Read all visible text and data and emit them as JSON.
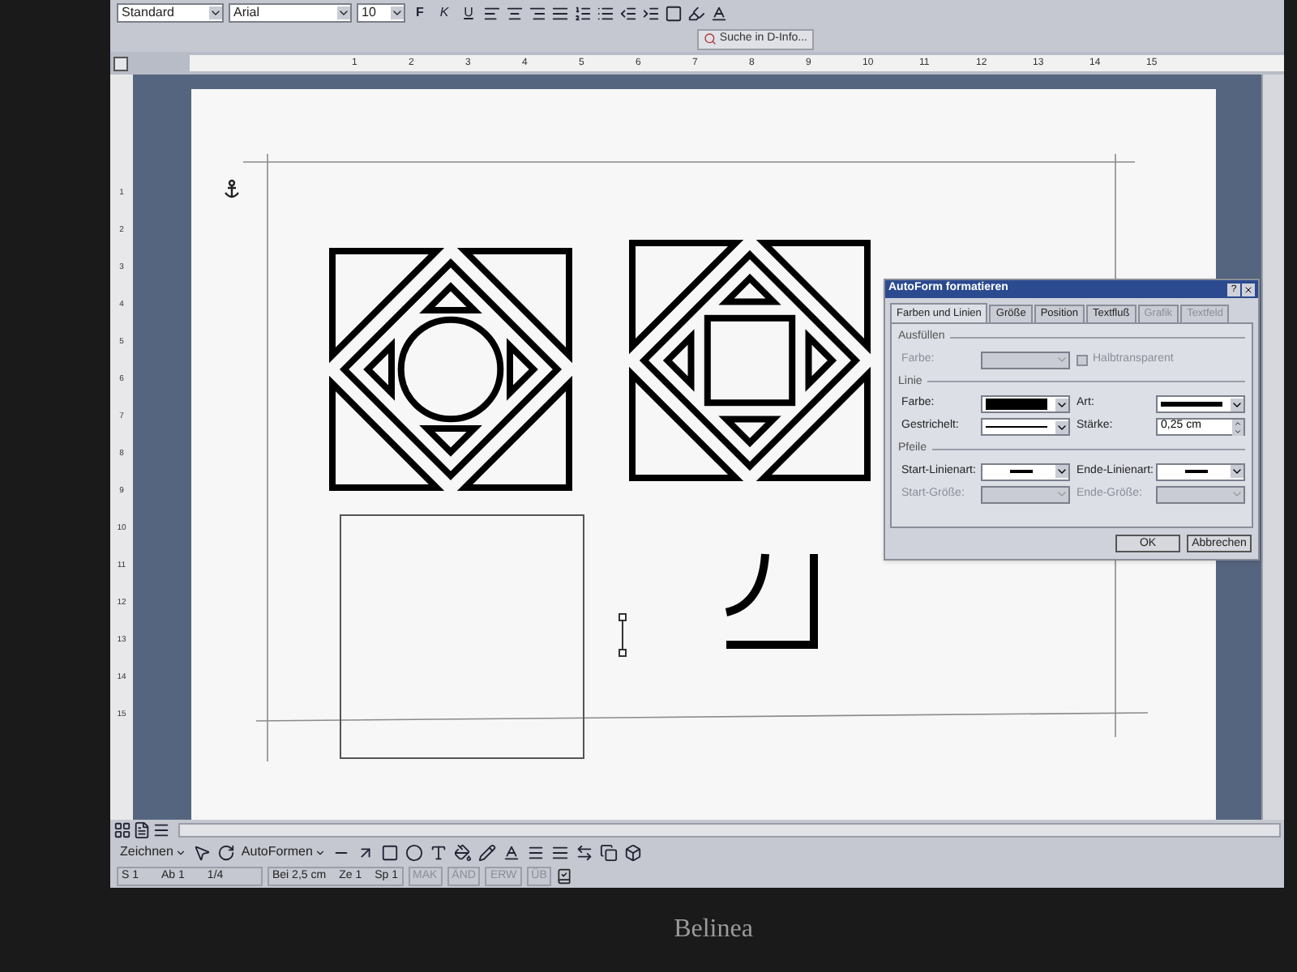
{
  "format_toolbar": {
    "style": "Standard",
    "font": "Arial",
    "size": "10",
    "buttons": [
      {
        "label": "F",
        "kind": "bold"
      },
      {
        "label": "K",
        "kind": "italic"
      },
      {
        "label": "U",
        "kind": "underline"
      }
    ]
  },
  "task_pane_search": {
    "label": "Suche in D-Info..."
  },
  "ruler": {
    "marks": [
      "1",
      "2",
      "3",
      "4",
      "5",
      "6",
      "7",
      "8",
      "9",
      "10",
      "11",
      "12",
      "13",
      "14",
      "15"
    ]
  },
  "vertical_ruler": {
    "marks": [
      "1",
      "2",
      "3",
      "4",
      "5",
      "6",
      "7",
      "8",
      "9",
      "10",
      "11",
      "12",
      "13",
      "14",
      "15"
    ]
  },
  "dialog": {
    "title": "AutoForm formatieren",
    "help_button": "?",
    "tabs": [
      {
        "label": "Farben und Linien",
        "selected": true,
        "disabled": false
      },
      {
        "label": "Größe",
        "selected": false,
        "disabled": false
      },
      {
        "label": "Position",
        "selected": false,
        "disabled": false
      },
      {
        "label": "Textfluß",
        "selected": false,
        "disabled": false
      },
      {
        "label": "Grafik",
        "selected": false,
        "disabled": true
      },
      {
        "label": "Textfeld",
        "selected": false,
        "disabled": true
      }
    ],
    "sections": [
      {
        "title": "Ausfüllen",
        "fields": [
          {
            "kind": "empty",
            "label": "Farbe:",
            "disabled": true
          },
          {
            "kind": "checkbox",
            "label": "Halbtransparent",
            "checked": false,
            "disabled": true
          }
        ]
      },
      {
        "title": "Linie",
        "fields": [
          {
            "kind": "swatch",
            "label": "Farbe:",
            "disabled": false
          },
          {
            "kind": "thick",
            "label": "Art:",
            "disabled": false
          },
          {
            "kind": "thin",
            "label": "Gestrichelt:",
            "disabled": false
          },
          {
            "kind": "spinner",
            "label": "Stärke:",
            "value": "0,25 cm",
            "disabled": false
          }
        ]
      },
      {
        "title": "Pfeile",
        "fields": [
          {
            "kind": "dash",
            "label": "Start-Linienart:",
            "disabled": false
          },
          {
            "kind": "dash",
            "label": "Ende-Linienart:",
            "disabled": false
          },
          {
            "kind": "empty",
            "label": "Start-Größe:",
            "disabled": true
          },
          {
            "kind": "empty",
            "label": "Ende-Größe:",
            "disabled": true
          }
        ]
      }
    ],
    "buttons": [
      "OK",
      "Abbrechen"
    ]
  },
  "drawing_toolbar": {
    "draw_menu": "Zeichnen",
    "autoshapes_menu": "AutoFormen"
  },
  "status_bar": {
    "position": [
      "S 1",
      "Ab 1",
      "1/4"
    ],
    "cursor": [
      "Bei 2,5 cm",
      "Ze 1",
      "Sp 1"
    ],
    "modes": [
      {
        "text": "MAK",
        "disabled": true
      },
      {
        "text": "ÄND",
        "disabled": true
      },
      {
        "text": "ERW",
        "disabled": true
      },
      {
        "text": "ÜB",
        "disabled": true
      }
    ]
  },
  "monitor": {
    "brand": "Belinea"
  }
}
